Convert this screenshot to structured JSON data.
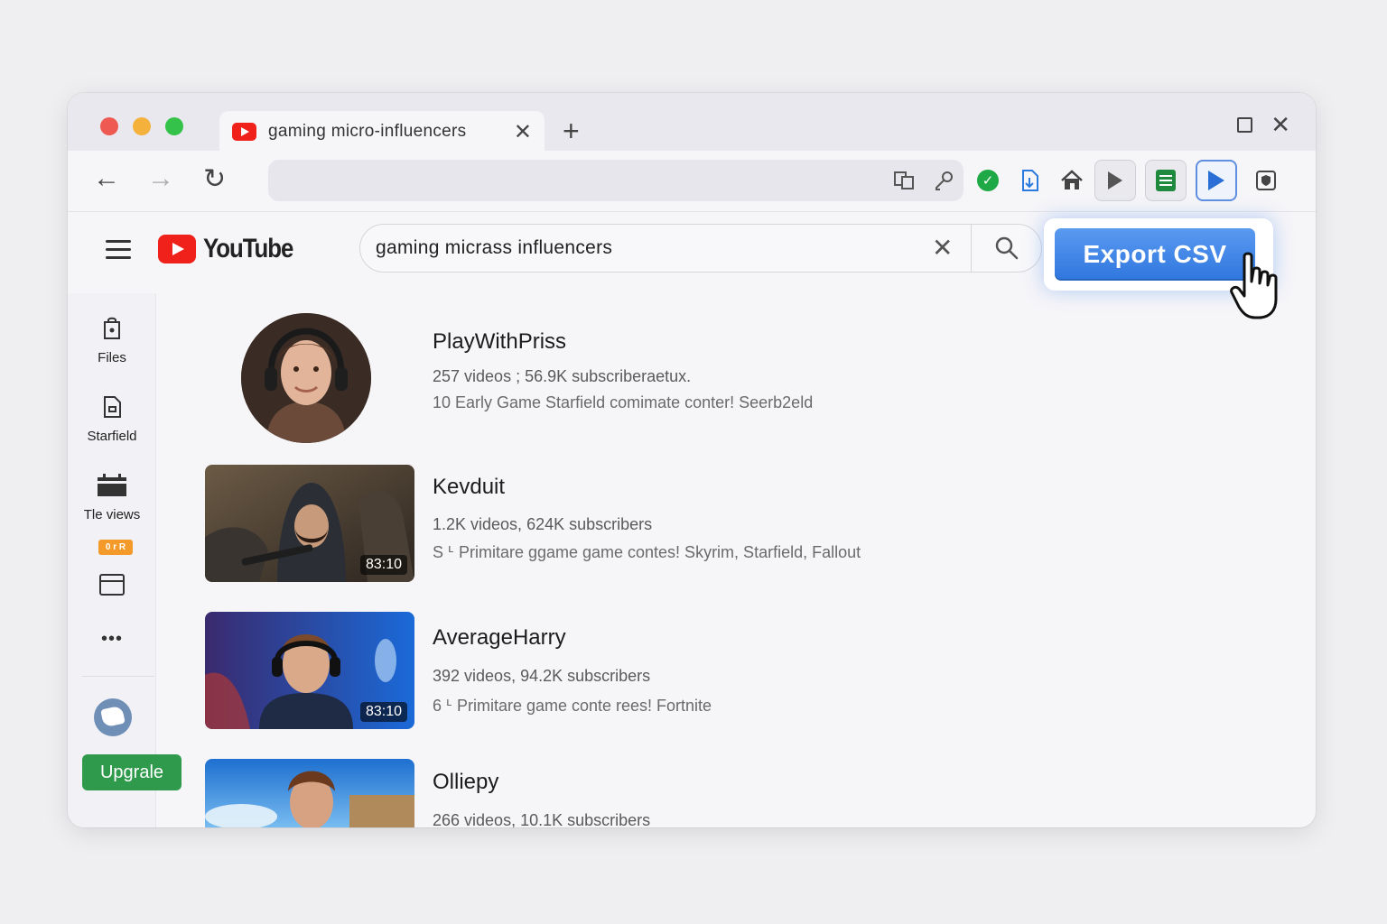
{
  "browser": {
    "tab_title": "gaming micro-influencers",
    "tab_close": "✕",
    "new_tab": "+",
    "win_close": "✕"
  },
  "nav": {
    "back": "←",
    "forward": "→",
    "reload": "↻"
  },
  "youtube": {
    "logo_text": "YouTube",
    "search_value": "gaming micrass influencers",
    "clear": "✕",
    "export_label": "Export CSV"
  },
  "sidebar": {
    "items": [
      {
        "label": "Files",
        "icon": "lock-file-icon"
      },
      {
        "label": "Starfield",
        "icon": "document-icon"
      },
      {
        "label": "Tle views",
        "icon": "calendar-icon"
      },
      {
        "label": "",
        "icon": "browser-window-icon"
      }
    ],
    "badge": "0 r R",
    "more": "•••",
    "upgrade_label": "Upgrale"
  },
  "results": [
    {
      "name": "PlayWithPriss",
      "meta": "257 videos ; 56.9K subscriberaetux.",
      "desc": "10 Early Game Starfield comimate conter! Seerb2eld"
    },
    {
      "name": "Kevduit",
      "meta": "1.2K videos, 624K subscribers",
      "desc": "S ᒻ Primitare ggame game contes! Skyrim, Starfield, Fallout",
      "duration": "83:10"
    },
    {
      "name": "AverageHarry",
      "meta": "392 videos, 94.2K subscribers",
      "desc": "6 ᒻ Primitare game conte rees! Fortnite",
      "duration": "83:10"
    },
    {
      "name": "Olliepy",
      "meta": "266 videos, 10.1K subscribers"
    }
  ],
  "colors": {
    "youtube_red": "#f0201a",
    "export_blue": "#2f76de",
    "upgrade_green": "#2f9a4b"
  }
}
